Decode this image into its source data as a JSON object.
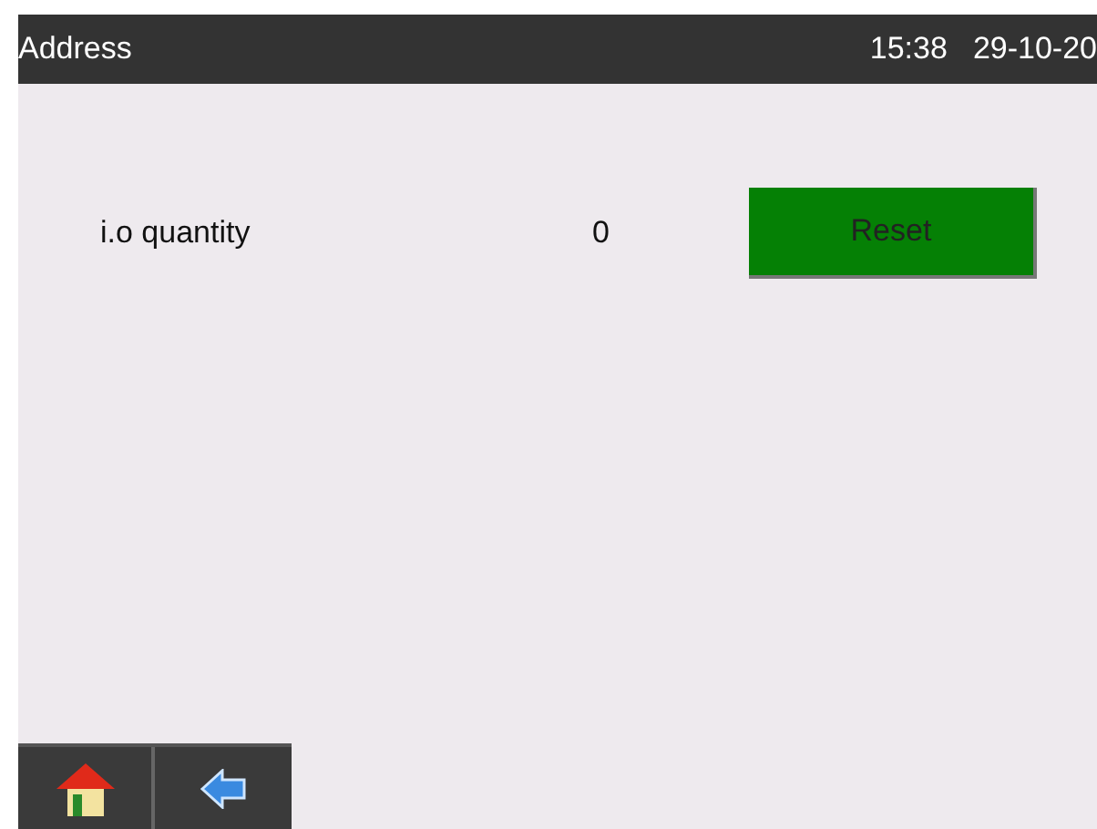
{
  "header": {
    "title": "Address",
    "time": "15:38",
    "date": "29-10-20"
  },
  "rows": [
    {
      "label": "i.o quantity",
      "value": "0",
      "button": "Reset"
    }
  ]
}
